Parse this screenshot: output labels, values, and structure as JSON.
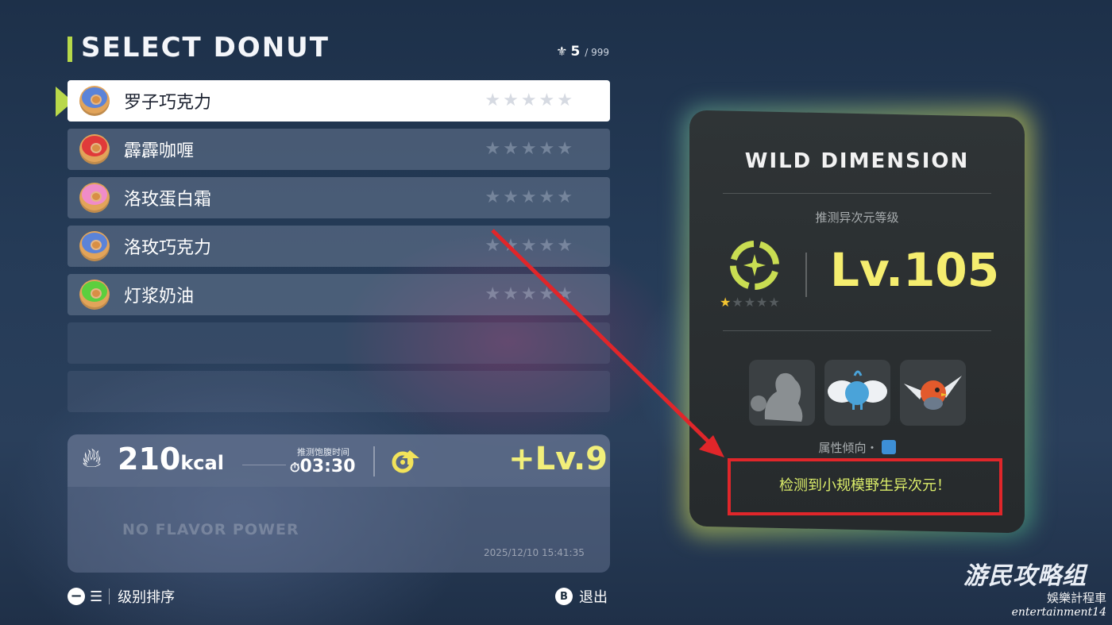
{
  "header": {
    "title": "SELECT DONUT",
    "count": "5",
    "count_max": "/ 999"
  },
  "donuts": [
    {
      "name": "罗子巧克力",
      "stars": "★★★★★",
      "frost": "#5b83d8",
      "selected": true
    },
    {
      "name": "霹霹咖喱",
      "stars": "★★★★★",
      "frost": "#e03a3a",
      "selected": false
    },
    {
      "name": "洛玫蛋白霜",
      "stars": "★★★★★",
      "frost": "#f08cc8",
      "selected": false
    },
    {
      "name": "洛玫巧克力",
      "stars": "★★★★★",
      "frost": "#5b83d8",
      "selected": false
    },
    {
      "name": "灯浆奶油",
      "stars": "★★★★★",
      "frost": "#5ccf3e",
      "selected": false
    }
  ],
  "info": {
    "kcal_value": "210",
    "kcal_unit": "kcal",
    "time_label": "推测饱腹时间",
    "time_value": "03:30",
    "level_bonus": "+Lv.9",
    "no_flavor": "NO FLAVOR POWER",
    "timestamp": "2025/12/10 15:41:35"
  },
  "footer": {
    "sort_label": "级别排序",
    "exit_key": "B",
    "exit_label": "退出"
  },
  "card": {
    "title": "WILD DIMENSION",
    "est_label": "推测异次元等级",
    "level": "Lv.105",
    "stars_on": "★",
    "stars_off": "★★★★",
    "attr_label": "属性倾向・",
    "detect_message": "检测到小规模野生异次元！"
  },
  "watermark": {
    "line1": "游民攻略组",
    "line2": "娛樂計程車",
    "line3": "entertainment14"
  },
  "colors": {
    "accent_green": "#b9d84a",
    "level_yellow": "#f5ed6f",
    "highlight_red": "#e0262a"
  }
}
